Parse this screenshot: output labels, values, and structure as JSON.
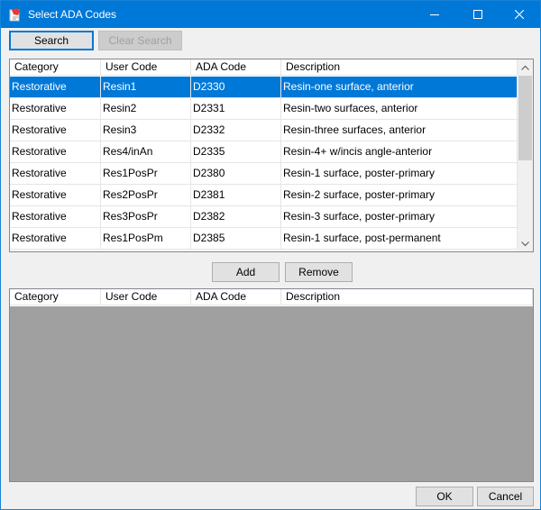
{
  "window": {
    "title": "Select ADA Codes"
  },
  "toolbar": {
    "search_label": "Search",
    "clear_search_label": "Clear Search"
  },
  "columns": [
    "Category",
    "User Code",
    "ADA Code",
    "Description"
  ],
  "results": [
    {
      "category": "Restorative",
      "user_code": "Resin1",
      "ada_code": "D2330",
      "description": "Resin-one surface, anterior",
      "selected": true
    },
    {
      "category": "Restorative",
      "user_code": "Resin2",
      "ada_code": "D2331",
      "description": "Resin-two surfaces, anterior"
    },
    {
      "category": "Restorative",
      "user_code": "Resin3",
      "ada_code": "D2332",
      "description": "Resin-three surfaces, anterior"
    },
    {
      "category": "Restorative",
      "user_code": "Res4/inAn",
      "ada_code": "D2335",
      "description": "Resin-4+ w/incis angle-anterior"
    },
    {
      "category": "Restorative",
      "user_code": "Res1PosPr",
      "ada_code": "D2380",
      "description": "Resin-1 surface, poster-primary"
    },
    {
      "category": "Restorative",
      "user_code": "Res2PosPr",
      "ada_code": "D2381",
      "description": "Resin-2 surface, poster-primary"
    },
    {
      "category": "Restorative",
      "user_code": "Res3PosPr",
      "ada_code": "D2382",
      "description": "Resin-3 surface, poster-primary"
    },
    {
      "category": "Restorative",
      "user_code": "Res1PosPm",
      "ada_code": "D2385",
      "description": "Resin-1 surface, post-permanent"
    }
  ],
  "middle_buttons": {
    "add_label": "Add",
    "remove_label": "Remove"
  },
  "footer": {
    "ok_label": "OK",
    "cancel_label": "Cancel"
  },
  "colors": {
    "titlebar": "#0078d7",
    "selection": "#0078d7",
    "empty_grid": "#a0a0a0"
  }
}
